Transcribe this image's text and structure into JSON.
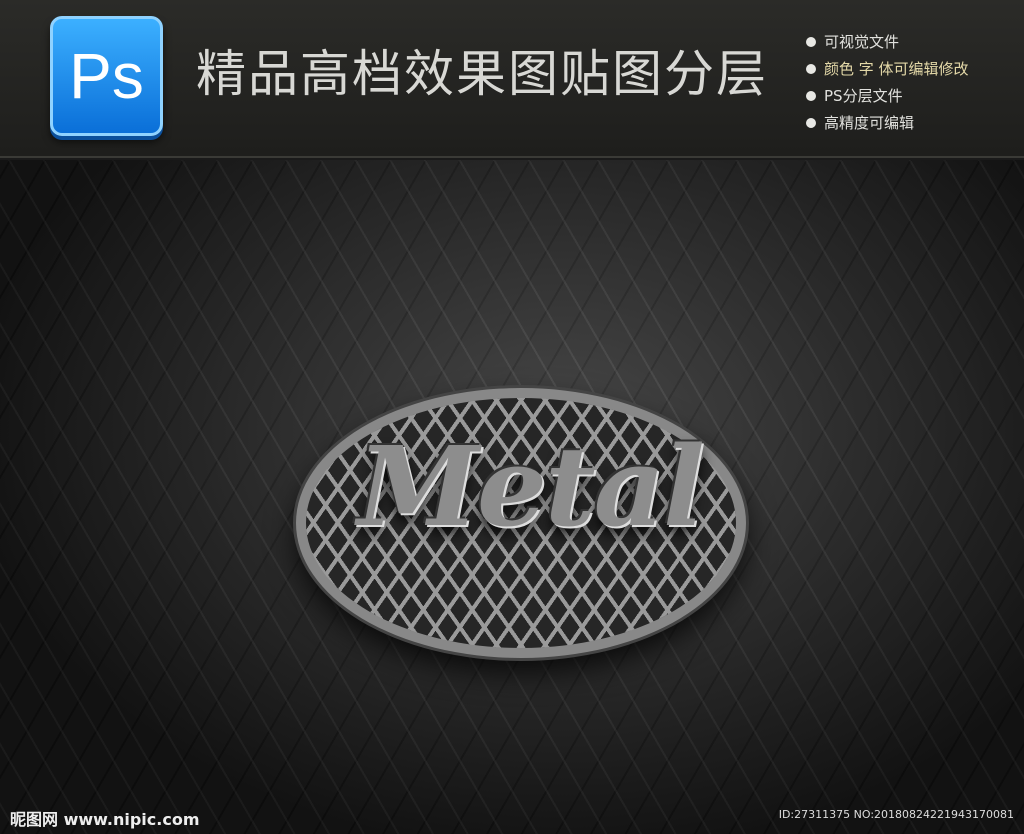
{
  "header": {
    "logo_text": "Ps",
    "title": "精品高档效果图贴图分层",
    "features": [
      "可视觉文件",
      "颜色 字 体可编辑修改",
      "PS分层文件",
      "高精度可编辑"
    ]
  },
  "scene": {
    "emblem_text": "Metal"
  },
  "footer": {
    "watermark": "昵图网 www.nipic.com",
    "id_text": "ID:27311375 NO:20180824221943170081"
  }
}
